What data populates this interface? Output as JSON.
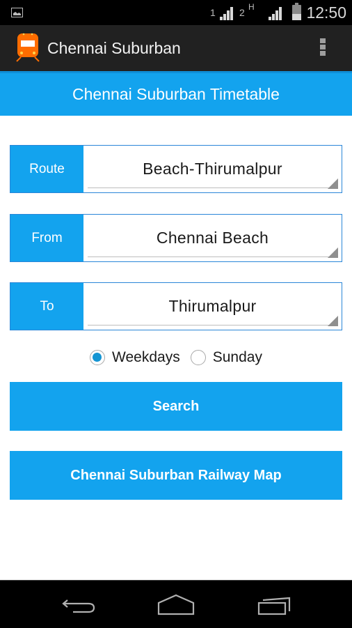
{
  "status_bar": {
    "sim1_label": "1",
    "sim2_label": "2",
    "network_type": "H",
    "time": "12:50",
    "icons": [
      "gallery-icon",
      "signal-icon",
      "signal-icon",
      "battery-charging-icon"
    ]
  },
  "action_bar": {
    "title": "Chennai Suburban",
    "app_icon": "train-icon",
    "menu_icon": "overflow-menu-icon"
  },
  "header": {
    "title": "Chennai Suburban Timetable"
  },
  "form": {
    "route": {
      "label": "Route",
      "value": "Beach-Thirumalpur"
    },
    "from": {
      "label": "From",
      "value": "Chennai Beach"
    },
    "to": {
      "label": "To",
      "value": "Thirumalpur"
    },
    "day_options": [
      {
        "label": "Weekdays",
        "checked": true
      },
      {
        "label": "Sunday",
        "checked": false
      }
    ]
  },
  "buttons": {
    "search": "Search",
    "railway_map": "Chennai Suburban Railway Map"
  },
  "nav_bar": {
    "icons": [
      "back-icon",
      "home-icon",
      "recent-apps-icon"
    ]
  },
  "colors": {
    "accent": "#13a3ee",
    "action_bar": "#212121",
    "app_icon": "#ff6d00",
    "radio_checked": "#1595d3"
  }
}
